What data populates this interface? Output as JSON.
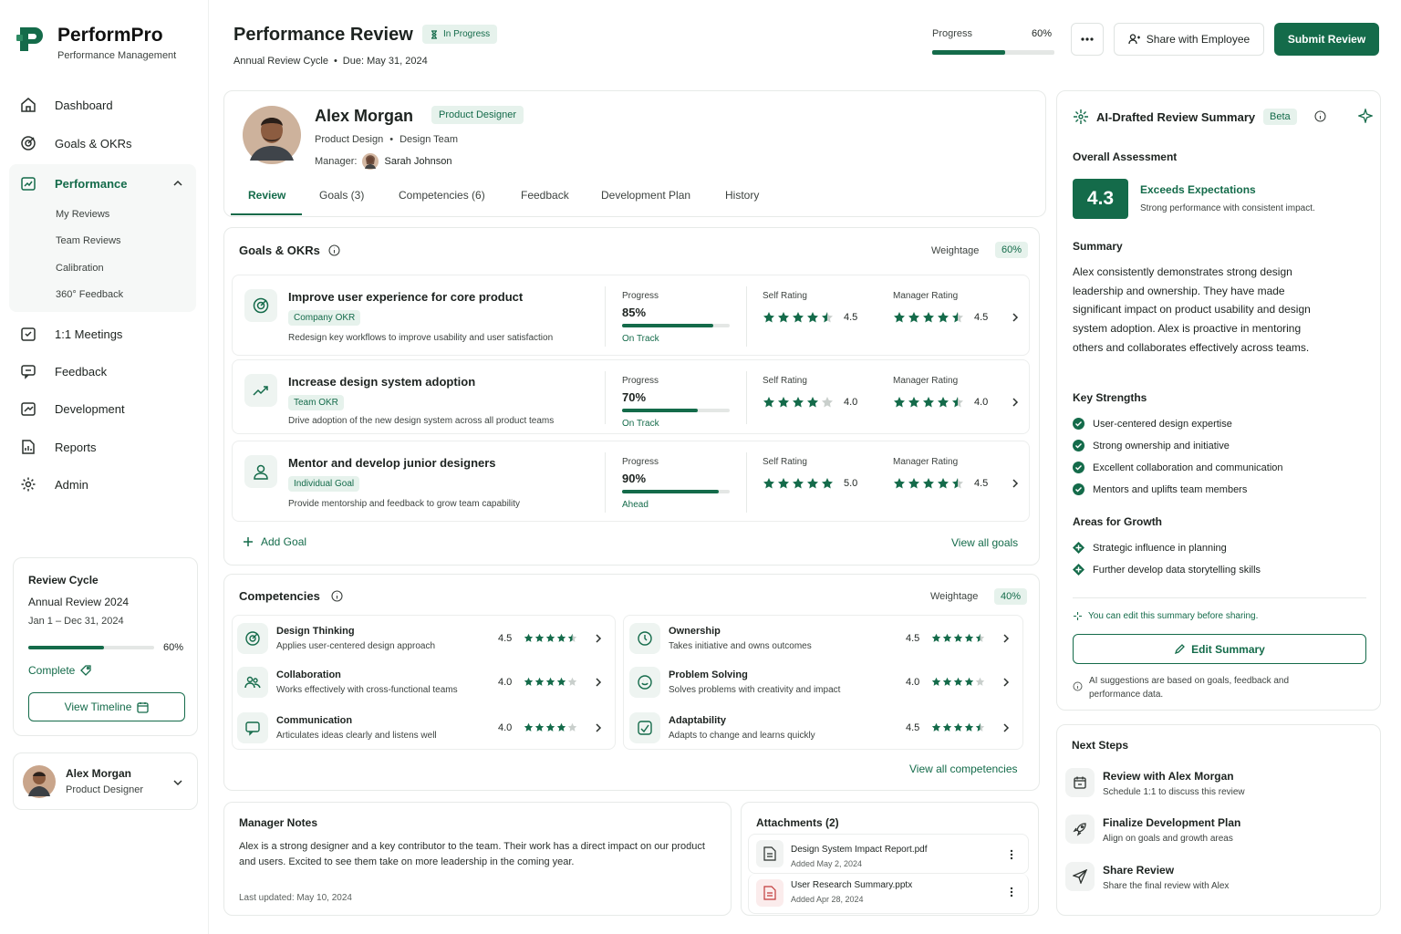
{
  "brand": {
    "name": "PerformPro",
    "tagline": "Performance Management"
  },
  "nav": {
    "dashboard": "Dashboard",
    "goals": "Goals & OKRs",
    "performance": "Performance",
    "performance_sub": [
      "My Reviews",
      "Team Reviews",
      "Calibration",
      "360° Feedback"
    ],
    "meetings": "1:1 Meetings",
    "feedback": "Feedback",
    "development": "Development",
    "reports": "Reports",
    "admin": "Admin"
  },
  "cycle": {
    "heading": "Review Cycle",
    "name": "Annual Review 2024",
    "dates": "Jan 1 – Dec 31, 2024",
    "progress": 60,
    "progress_label": "60%",
    "status": "Complete",
    "timeline_btn": "View Timeline"
  },
  "user": {
    "name": "Alex Morgan",
    "role": "Product Designer"
  },
  "header": {
    "title": "Performance Review",
    "status": "In Progress",
    "cycle": "Annual Review Cycle",
    "due": "Due: May 31, 2024",
    "progress_label": "Progress",
    "progress_value": "60%",
    "progress": 60,
    "share_btn": "Share with Employee",
    "submit_btn": "Submit Review"
  },
  "employee": {
    "name": "Alex Morgan",
    "role_badge": "Product Designer",
    "department": "Product Design",
    "team": "Design Team",
    "manager_label": "Manager:",
    "manager": "Sarah Johnson"
  },
  "tabs": [
    "Review",
    "Goals (3)",
    "Competencies (6)",
    "Feedback",
    "Development Plan",
    "History"
  ],
  "goals_section": {
    "title": "Goals & OKRs",
    "weightage_label": "Weightage",
    "weightage": "60%",
    "progress_label": "Progress",
    "self_label": "Self Rating",
    "manager_label": "Manager Rating",
    "items": [
      {
        "title": "Improve user experience for core product",
        "tag": "Company OKR",
        "desc": "Redesign key workflows to improve usability and user satisfaction",
        "progress_text": "85%",
        "progress": 85,
        "status": "On Track",
        "self": "4.5",
        "self_stars": 4.5,
        "manager": "4.5",
        "manager_stars": 4.5
      },
      {
        "title": "Increase design system adoption",
        "tag": "Team OKR",
        "desc": "Drive adoption of the new design system across all product teams",
        "progress_text": "70%",
        "progress": 70,
        "status": "On Track",
        "self": "4.0",
        "self_stars": 4.0,
        "manager": "4.0",
        "manager_stars": 4.5
      },
      {
        "title": "Mentor and develop junior designers",
        "tag": "Individual Goal",
        "desc": "Provide mentorship and feedback to grow team capability",
        "progress_text": "90%",
        "progress": 90,
        "status": "Ahead",
        "self": "5.0",
        "self_stars": 5.0,
        "manager": "4.5",
        "manager_stars": 4.5
      }
    ],
    "add_goal": "Add Goal",
    "view_all": "View all goals"
  },
  "competencies": {
    "title": "Competencies",
    "weightage_label": "Weightage",
    "weightage": "40%",
    "items": [
      {
        "title": "Design Thinking",
        "desc": "Applies user-centered design approach",
        "rating": "4.5",
        "stars": 4.5
      },
      {
        "title": "Ownership",
        "desc": "Takes initiative and owns outcomes",
        "rating": "4.5",
        "stars": 4.5
      },
      {
        "title": "Collaboration",
        "desc": "Works effectively with cross-functional teams",
        "rating": "4.0",
        "stars": 4.0
      },
      {
        "title": "Problem Solving",
        "desc": "Solves problems with creativity and impact",
        "rating": "4.0",
        "stars": 4.0
      },
      {
        "title": "Communication",
        "desc": "Articulates ideas clearly and listens well",
        "rating": "4.0",
        "stars": 4.0
      },
      {
        "title": "Adaptability",
        "desc": "Adapts to change and learns quickly",
        "rating": "4.5",
        "stars": 4.5
      }
    ],
    "view_all": "View all competencies"
  },
  "notes": {
    "title": "Manager Notes",
    "body": "Alex is a strong designer and a key contributor to the team. Their work has a direct impact on our product and users. Excited to see them take on more leadership in the coming year.",
    "updated": "Last updated: May 10, 2024"
  },
  "attachments": {
    "title": "Attachments (2)",
    "items": [
      {
        "name": "Design System Impact Report.pdf",
        "date": "Added May 2, 2024"
      },
      {
        "name": "User Research Summary.pptx",
        "date": "Added Apr 28, 2024"
      }
    ]
  },
  "ai": {
    "title": "AI-Drafted Review Summary",
    "badge": "Beta",
    "overall_heading": "Overall Assessment",
    "score": "4.3",
    "score_label": "Exceeds Expectations",
    "score_desc": "Strong performance with consistent impact.",
    "summary_heading": "Summary",
    "summary": "Alex consistently demonstrates strong design leadership and ownership. They have made significant impact on product usability and design system adoption. Alex is proactive in mentoring others and collaborates effectively across teams.",
    "strengths_heading": "Key Strengths",
    "strengths": [
      "User-centered design expertise",
      "Strong ownership and initiative",
      "Excellent collaboration and communication",
      "Mentors and uplifts team members"
    ],
    "growth_heading": "Areas for Growth",
    "growth": [
      "Strategic influence in planning",
      "Further develop data storytelling skills"
    ],
    "edit_hint": "You can edit this summary before sharing.",
    "edit_btn": "Edit Summary",
    "disclaimer": "AI suggestions are based on goals, feedback and performance data."
  },
  "next_steps": {
    "title": "Next Steps",
    "items": [
      {
        "title": "Review with Alex Morgan",
        "desc": "Schedule 1:1 to discuss this review"
      },
      {
        "title": "Finalize Development Plan",
        "desc": "Align on goals and growth areas"
      },
      {
        "title": "Share Review",
        "desc": "Share the final review with Alex"
      }
    ]
  },
  "colors": {
    "primary": "#146b4a",
    "light": "#e6f2ec",
    "border": "#e7eae8"
  }
}
